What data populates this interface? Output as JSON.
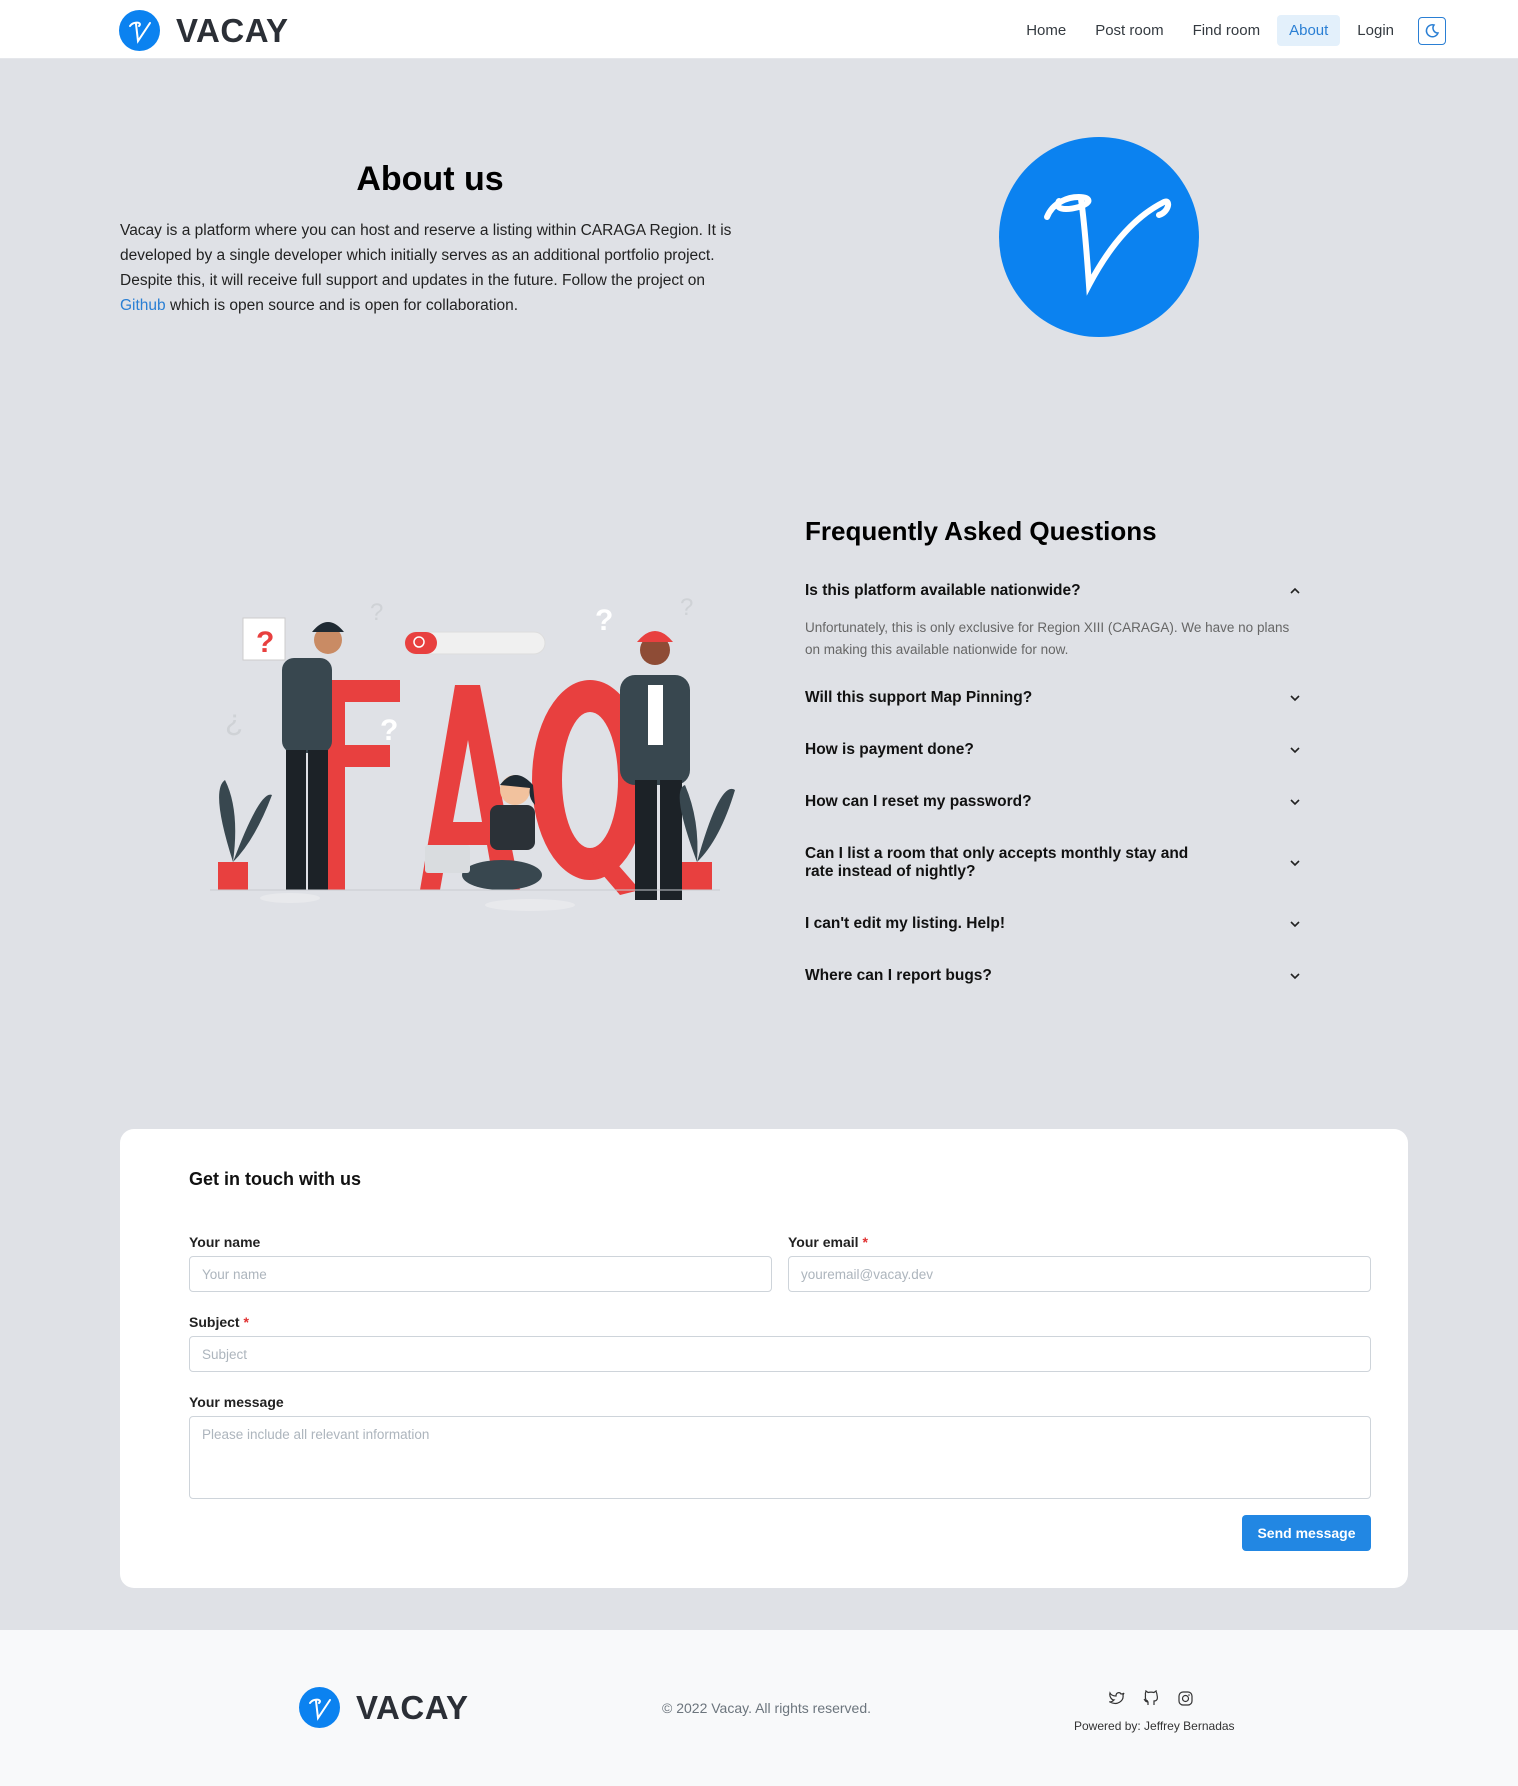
{
  "header": {
    "brand": "VACAY",
    "nav": [
      {
        "label": "Home"
      },
      {
        "label": "Post room"
      },
      {
        "label": "Find room"
      },
      {
        "label": "About",
        "active": true
      },
      {
        "label": "Login"
      }
    ],
    "theme_icon": "moon-icon"
  },
  "about": {
    "title": "About us",
    "text_before_link": "Vacay is a platform where you can host and reserve a listing within CARAGA Region. It is developed by a single developer which initially serves as an additional portfolio project. Despite this, it will receive full support and updates in the future. Follow the project on ",
    "link_text": "Github",
    "text_after_link": " which is open source and is open for collaboration."
  },
  "faq": {
    "title": "Frequently Asked Questions",
    "illustration_text": "FAQ",
    "items": [
      {
        "question": "Is this platform available nationwide?",
        "answer": "Unfortunately, this is only exclusive for Region XIII (CARAGA). We have no plans on making this available nationwide for now.",
        "open": true
      },
      {
        "question": "Will this support Map Pinning?"
      },
      {
        "question": "How is payment done?"
      },
      {
        "question": "How can I reset my password?"
      },
      {
        "question": "Can I list a room that only accepts monthly stay and rate instead of nightly?"
      },
      {
        "question": "I can't edit my listing. Help!"
      },
      {
        "question": "Where can I report bugs?"
      }
    ]
  },
  "contact": {
    "title": "Get in touch with us",
    "name_label": "Your name",
    "name_placeholder": "Your name",
    "email_label": "Your email",
    "email_placeholder": "youremail@vacay.dev",
    "subject_label": "Subject",
    "subject_placeholder": "Subject",
    "message_label": "Your message",
    "message_placeholder": "Please include all relevant information",
    "required_mark": "*",
    "send_label": "Send message"
  },
  "footer": {
    "brand": "VACAY",
    "copyright": "© 2022 Vacay. All rights reserved.",
    "powered_by": "Powered by: Jeffrey Bernadas",
    "social_icons": [
      "twitter-icon",
      "github-icon",
      "instagram-icon"
    ]
  },
  "colors": {
    "brand_blue": "#0b82f0",
    "link_blue": "#2a7fd4",
    "button_blue": "#2287e3",
    "page_bg": "#dfe1e6",
    "faq_red": "#e8403f"
  }
}
